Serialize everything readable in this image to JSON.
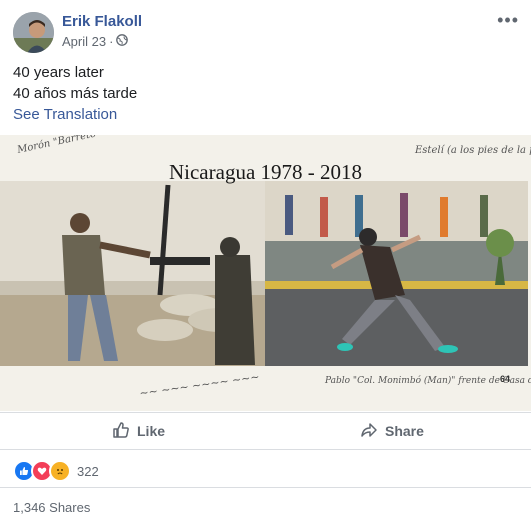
{
  "post": {
    "author": "Erik Flakoll",
    "date": "April 23",
    "separator": "·",
    "privacy_icon": "globe-icon",
    "more_icon": "more-options-icon",
    "text_line1": "40 years later",
    "text_line2": "40 años más tarde",
    "see_translation": "See Translation"
  },
  "photo": {
    "title": "Nicaragua  1978 - 2018",
    "handwriting_top_left": "Morón \"Barreto\" Pedro Juan Placio Bola de Placa",
    "handwriting_top_right": "Estelí (a los pies de la puerta del ... de AA)",
    "handwriting_bottom_right": "Pablo \"Col. Monimbó (Man)\" frente de Casa detrás de la Iglesia",
    "badge": "64"
  },
  "actions": {
    "like_label": "Like",
    "like_icon": "thumbs-up-icon",
    "share_label": "Share",
    "share_icon": "share-arrow-icon"
  },
  "reactions": {
    "icons": [
      "like-reaction-icon",
      "love-reaction-icon",
      "sad-reaction-icon"
    ],
    "count": "322",
    "colors": {
      "like": "#1877f2",
      "love": "#f33e58",
      "sad": "#f7b125"
    }
  },
  "shares": {
    "label": "1,346 Shares"
  }
}
